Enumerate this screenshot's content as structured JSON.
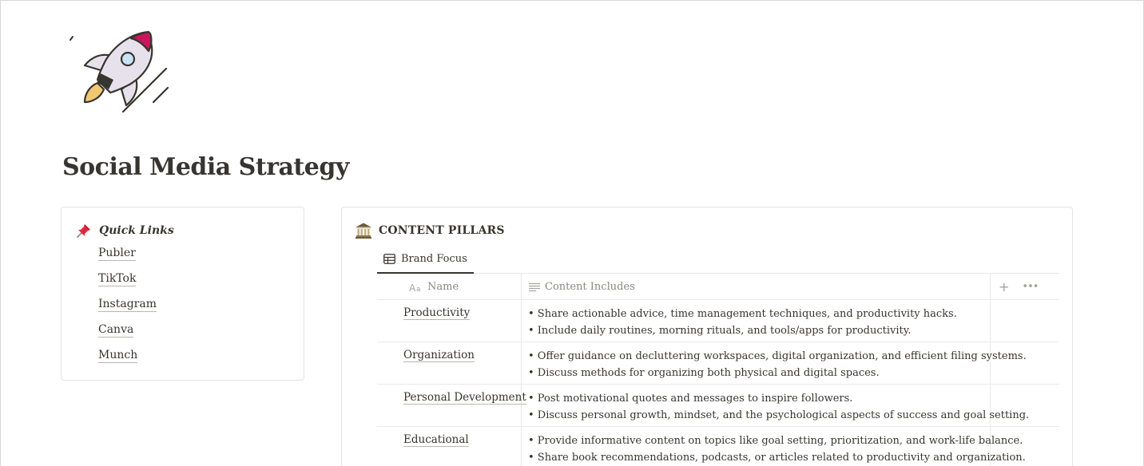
{
  "page": {
    "title": "Social Media Strategy",
    "icon": "rocket-icon"
  },
  "quick_links": {
    "icon": "pushpin-icon",
    "title": "Quick Links",
    "items": [
      {
        "label": "Publer"
      },
      {
        "label": "TikTok"
      },
      {
        "label": "Instagram"
      },
      {
        "label": "Canva"
      },
      {
        "label": "Munch"
      }
    ]
  },
  "content_pillars": {
    "icon": "classical-building-icon",
    "title": "CONTENT PILLARS",
    "tab": {
      "label": "Brand Focus",
      "icon": "table-icon"
    },
    "columns": {
      "name": {
        "label": "Name",
        "icon": "text-type-icon"
      },
      "content": {
        "label": "Content Includes",
        "icon": "text-lines-icon"
      }
    },
    "rows": [
      {
        "name": "Productivity",
        "lines": [
          "• Share actionable advice, time management techniques, and productivity hacks.",
          "• Include daily routines, morning rituals, and tools/apps for productivity."
        ]
      },
      {
        "name": "Organization",
        "lines": [
          "• Offer guidance on decluttering workspaces, digital organization, and efficient filing systems.",
          "• Discuss methods for organizing both physical and digital spaces."
        ]
      },
      {
        "name": "Personal Development",
        "lines": [
          "• Post motivational quotes and messages to inspire followers.",
          "• Discuss personal growth, mindset, and the psychological aspects of success and goal setting."
        ]
      },
      {
        "name": "Educational",
        "lines": [
          "• Provide informative content on topics like goal setting, prioritization, and work-life balance.",
          "• Share book recommendations, podcasts, or articles related to productivity and organization."
        ]
      }
    ]
  }
}
